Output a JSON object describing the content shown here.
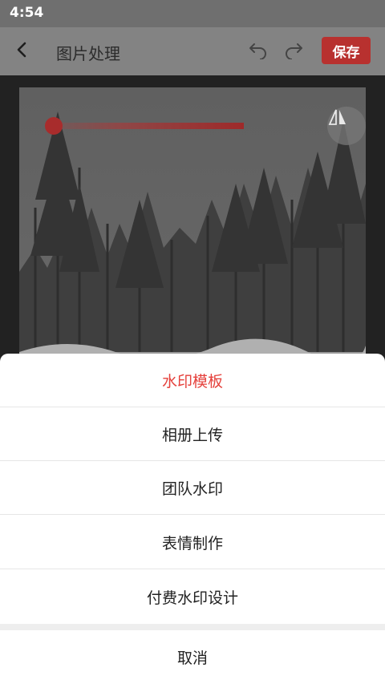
{
  "status_bar": {
    "time": "4:54"
  },
  "header": {
    "title": "图片处理",
    "back_icon": "chevron-left-icon",
    "undo_icon": "undo-icon",
    "redo_icon": "redo-icon",
    "save_label": "保存",
    "save_color": "#b8312f"
  },
  "editor": {
    "opacity_slider_level": 0.72,
    "flip_icon": "mirror-flip-icon",
    "accent_color": "#a82c2c"
  },
  "sheet": {
    "items": [
      {
        "label": "水印模板",
        "active": true
      },
      {
        "label": "相册上传",
        "active": false
      },
      {
        "label": "团队水印",
        "active": false
      },
      {
        "label": "表情制作",
        "active": false
      },
      {
        "label": "付费水印设计",
        "active": false
      }
    ],
    "cancel_label": "取消",
    "accent_color": "#e5413c"
  }
}
